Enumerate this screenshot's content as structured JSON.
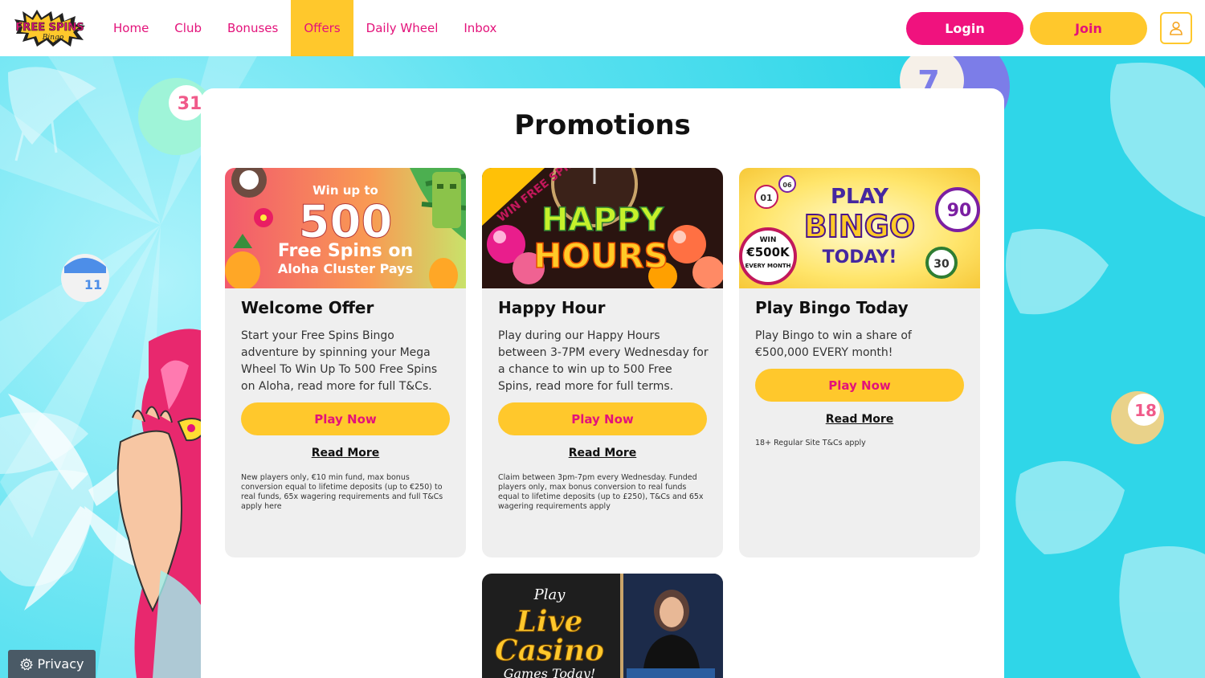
{
  "header": {
    "logo_text": "FREE SPINS Bingo",
    "nav": [
      {
        "label": "Home",
        "active": false
      },
      {
        "label": "Club",
        "active": false
      },
      {
        "label": "Bonuses",
        "active": false
      },
      {
        "label": "Offers",
        "active": true
      },
      {
        "label": "Daily Wheel",
        "active": false
      },
      {
        "label": "Inbox",
        "active": false
      }
    ],
    "login_label": "Login",
    "join_label": "Join",
    "account_icon": "user-icon"
  },
  "page": {
    "title": "Promotions"
  },
  "promos": [
    {
      "image_text": {
        "line1": "Win up to",
        "line2": "500",
        "line3": "Free Spins on",
        "line4": "Aloha Cluster Pays"
      },
      "title": "Welcome Offer",
      "description": "Start your Free Spins Bingo adventure by spinning your Mega Wheel To Win Up To 500 Free Spins on Aloha, read more for full T&Cs.",
      "button": "Play Now",
      "read_more": "Read More",
      "terms": "New players only, €10 min fund, max bonus conversion equal to lifetime deposits (up to €250) to real funds, 65x wagering requirements and full T&Cs apply here"
    },
    {
      "image_text": {
        "badge": "WIN FREE SPINS!",
        "line1": "HAPPY",
        "line2": "HOURS"
      },
      "title": "Happy Hour",
      "description": "Play during our Happy Hours between 3-7PM every Wednesday for a chance to win up to 500 Free Spins, read more for full terms.",
      "button": "Play Now",
      "read_more": "Read More",
      "terms": "Claim between 3pm-7pm every Wednesday. Funded players only, max bonus conversion to real funds equal to lifetime deposits (up to £250), T&Cs and 65x wagering requirements apply"
    },
    {
      "image_text": {
        "line1": "PLAY",
        "line2": "BINGO",
        "line3": "TODAY!",
        "badge1": "WIN",
        "badge2": "€500K",
        "badge3": "EVERY MONTH"
      },
      "title": "Play Bingo Today",
      "description": "Play Bingo to win a share of €500,000 EVERY month!",
      "button": "Play Now",
      "read_more": "Read More",
      "terms": "18+ Regular Site T&Cs apply"
    },
    {
      "image_text": {
        "line1": "Play",
        "line2": "Live",
        "line3": "Casino",
        "line4": "Games Today!"
      }
    }
  ],
  "decor": {
    "balls": [
      "31",
      "7",
      "11",
      "18",
      "30",
      "90",
      "06",
      "01"
    ]
  },
  "privacy": {
    "label": "Privacy",
    "icon": "gear-icon"
  },
  "colors": {
    "pink": "#e3127a",
    "yellow": "#ffc82c",
    "cyan": "#2fd6e8"
  }
}
